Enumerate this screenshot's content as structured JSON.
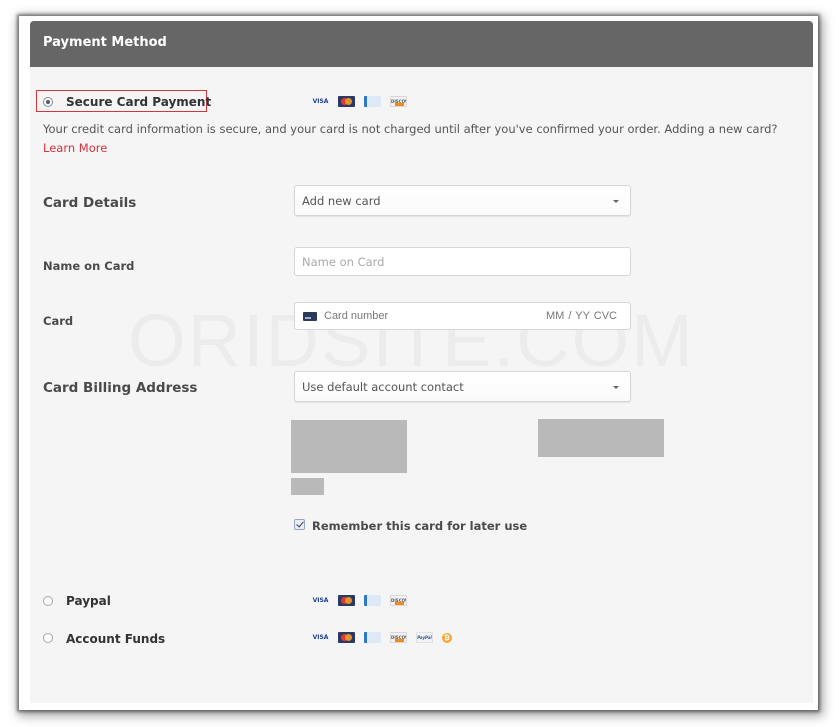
{
  "header": {
    "title": "Payment Method"
  },
  "payment_options": [
    {
      "label": "Secure Card Payment",
      "selected": true
    },
    {
      "label": "Paypal",
      "selected": false
    },
    {
      "label": "Account Funds",
      "selected": false
    }
  ],
  "card_logos": {
    "visa": "VISA",
    "discover": "DISCOVER",
    "paypal": "PayPal",
    "bitcoin": "₿"
  },
  "info": {
    "text": "Your credit card information is secure, and your card is not charged until after you've confirmed your order. Adding a new card?",
    "learn_more": "Learn More"
  },
  "form": {
    "card_details_label": "Card Details",
    "card_details_value": "Add new card",
    "name_label": "Name on Card",
    "name_placeholder": "Name on Card",
    "card_label": "Card",
    "card_number_placeholder": "Card number",
    "card_expiry_cvc": "MM / YY  CVC",
    "billing_label": "Card Billing Address",
    "billing_value": "Use default account contact",
    "remember_label": "Remember this card for later use",
    "remember_checked": true
  },
  "watermark": "ORIDSITE.COM",
  "colors": {
    "header_bg": "#666666",
    "accent_red": "#d8333f",
    "panel_bg": "#f5f5f5"
  }
}
